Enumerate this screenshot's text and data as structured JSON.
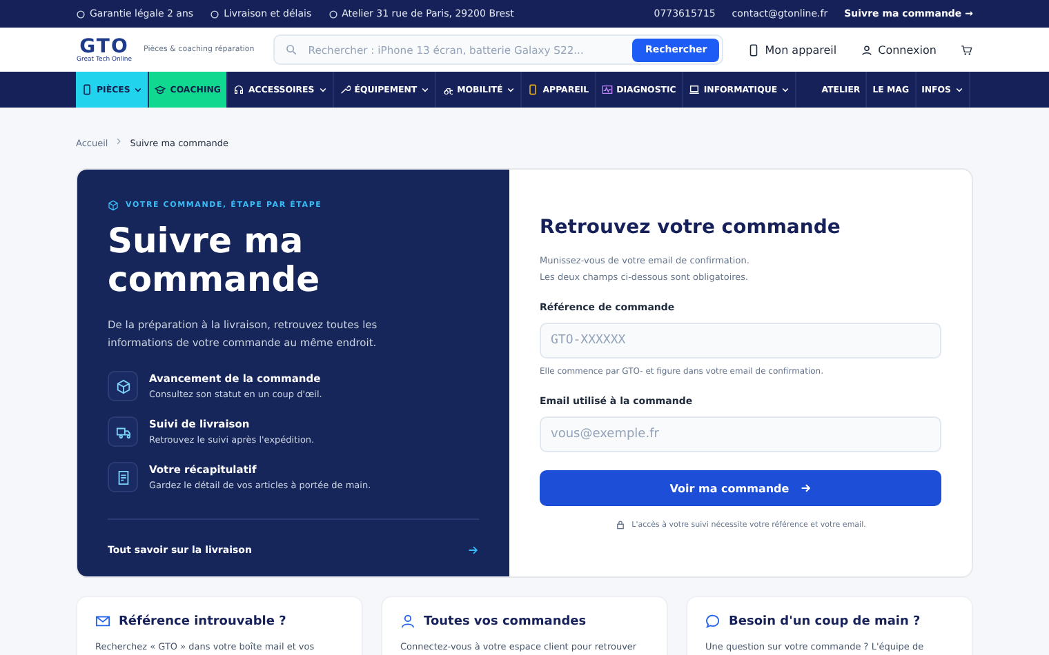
{
  "topbar": {
    "left": [
      "Garantie légale 2 ans",
      "Livraison et délais",
      "Atelier 31 rue de Paris, 29200 Brest"
    ],
    "phone": "0773615715",
    "email": "contact@gtonline.fr",
    "track_link": "Suivre ma commande →"
  },
  "header": {
    "logo": "GTO",
    "logo_sub": "Great Tech Online",
    "tagline": "Pièces & coaching réparation",
    "search": {
      "placeholder": "Rechercher : iPhone 13 écran, batterie Galaxy S22..."
    },
    "search_button": "Rechercher",
    "device": "Mon appareil",
    "login": "Connexion"
  },
  "nav": [
    {
      "label": "PIÈCES",
      "dropdown": true,
      "color": "#22d3ee"
    },
    {
      "label": "COACHING",
      "dropdown": false,
      "color": "#10d98f"
    },
    {
      "label": "ACCESSOIRES",
      "dropdown": true
    },
    {
      "label": "ÉQUIPEMENT",
      "dropdown": true
    },
    {
      "label": "MOBILITÉ",
      "dropdown": true
    },
    {
      "label": "APPAREIL",
      "dropdown": false
    },
    {
      "label": "DIAGNOSTIC",
      "dropdown": false
    },
    {
      "label": "INFORMATIQUE",
      "dropdown": true
    }
  ],
  "nav_right": [
    {
      "label": "ATELIER",
      "dropdown": false
    },
    {
      "label": "LE MAG",
      "dropdown": false
    },
    {
      "label": "INFOS",
      "dropdown": true
    }
  ],
  "breadcrumb": [
    "Accueil",
    "Suivre ma commande"
  ],
  "hero": {
    "eyebrow": "VOTRE COMMANDE, ÉTAPE PAR ÉTAPE",
    "title": "Suivre ma commande",
    "intro": "De la préparation à la livraison, retrouvez toutes les informations de votre commande au même endroit.",
    "features": [
      {
        "title": "Avancement de la commande",
        "text": "Consultez son statut en un coup d'œil."
      },
      {
        "title": "Suivi de livraison",
        "text": "Retrouvez le suivi après l'expédition."
      },
      {
        "title": "Votre récapitulatif",
        "text": "Gardez le détail de vos articles à portée de main."
      }
    ],
    "link": "Tout savoir sur la livraison"
  },
  "form": {
    "title": "Retrouvez votre commande",
    "intro": [
      "Munissez-vous de votre email de confirmation.",
      "Les deux champs ci-dessous sont obligatoires."
    ],
    "reference": {
      "label": "Référence de commande",
      "placeholder": "GTO-XXXXXX",
      "hint": "Elle commence par GTO- et figure dans votre email de confirmation."
    },
    "email": {
      "label": "Email utilisé à la commande",
      "placeholder": "vous@exemple.fr"
    },
    "submit": "Voir ma commande",
    "note": "L'accès à votre suivi nécessite votre référence et votre email."
  },
  "cards": [
    {
      "title": "Référence introuvable ?",
      "text": "Recherchez « GTO » dans votre boîte mail et vos"
    },
    {
      "title": "Toutes vos commandes",
      "text": "Connectez-vous à votre espace client pour retrouver"
    },
    {
      "title": "Besoin d'un coup de main ?",
      "text": "Une question sur votre commande ? L'équipe de"
    }
  ]
}
